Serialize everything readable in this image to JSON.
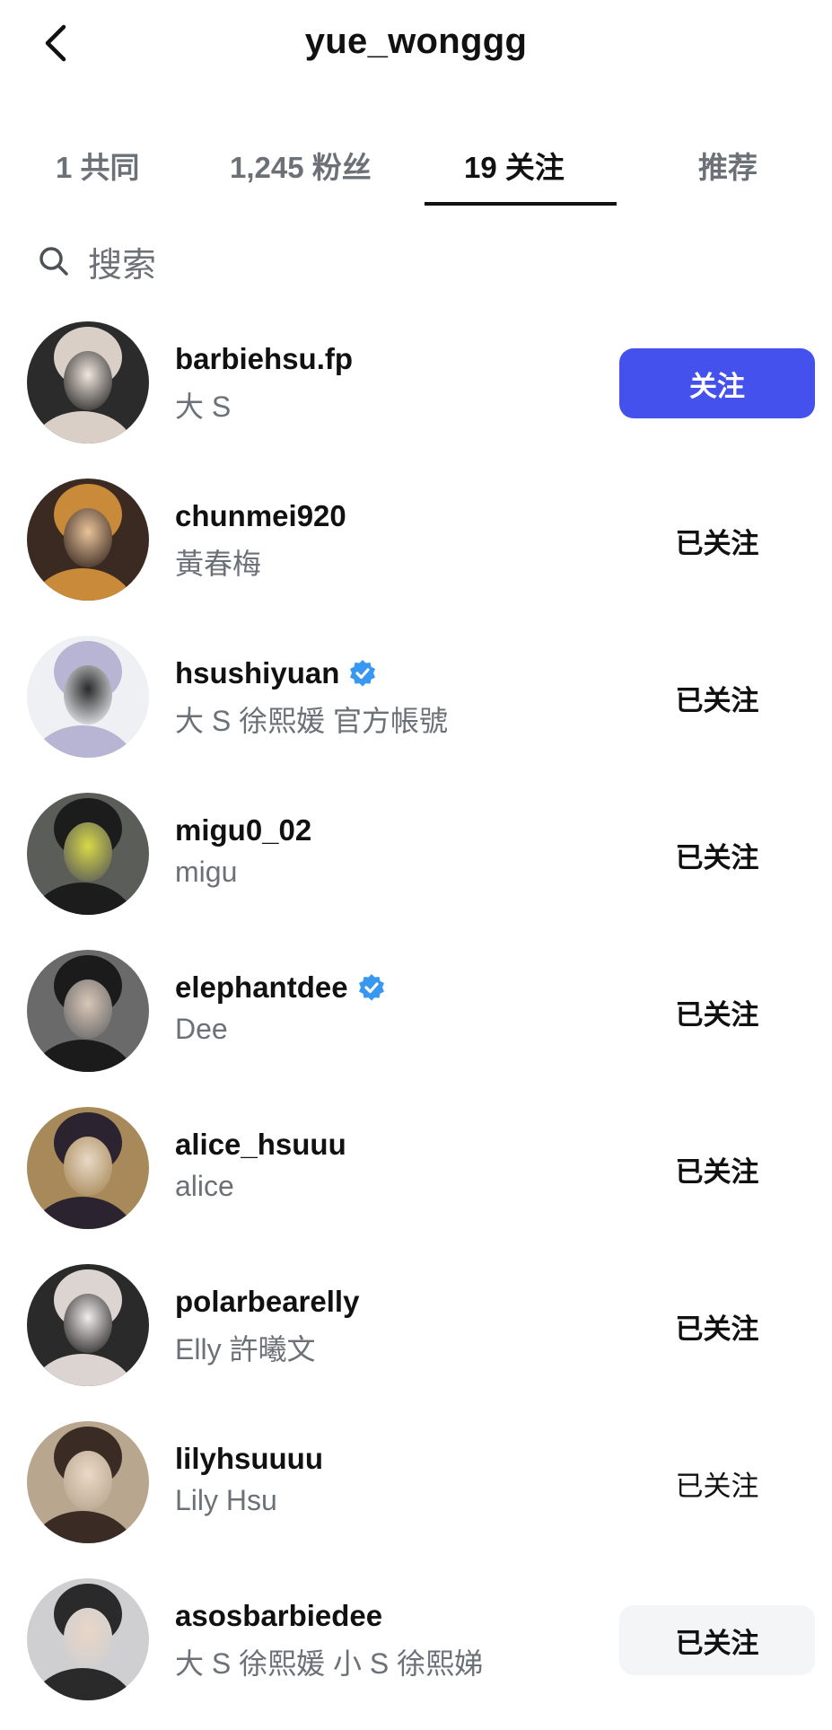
{
  "header": {
    "back_icon": "chevron-left-icon",
    "title": "yue_wonggg"
  },
  "tabs": [
    {
      "label": "1 共同",
      "active": false
    },
    {
      "label": "1,245 粉丝",
      "active": false
    },
    {
      "label": "19 关注",
      "active": true
    },
    {
      "label": "推荐",
      "active": false
    }
  ],
  "search": {
    "icon": "search-icon",
    "placeholder": "搜索"
  },
  "users": [
    {
      "username": "barbiehsu.fp",
      "full_name": "大 S",
      "verified": false,
      "button_label": "关注",
      "button_state": "follow",
      "avatar_colors": [
        "#2b2b2b",
        "#d9cfc6",
        "#f1e6dc"
      ]
    },
    {
      "username": "chunmei920",
      "full_name": "黃春梅",
      "verified": false,
      "button_label": "已关注",
      "button_state": "following",
      "avatar_colors": [
        "#3a2a22",
        "#c98a3a",
        "#e9c39a"
      ]
    },
    {
      "username": "hsushiyuan",
      "full_name": "大 S 徐熙媛  官方帳號",
      "verified": true,
      "button_label": "已关注",
      "button_state": "following",
      "avatar_colors": [
        "#eef0f4",
        "#b7b4d4",
        "#2a2a2a"
      ]
    },
    {
      "username": "migu0_02",
      "full_name": "migu",
      "verified": false,
      "button_label": "已关注",
      "button_state": "following",
      "avatar_colors": [
        "#5b5d58",
        "#1c1c1c",
        "#d8d848"
      ]
    },
    {
      "username": "elephantdee",
      "full_name": "Dee",
      "verified": true,
      "button_label": "已关注",
      "button_state": "following",
      "avatar_colors": [
        "#6a6a6a",
        "#1b1b1b",
        "#d9c6b8"
      ]
    },
    {
      "username": "alice_hsuuu",
      "full_name": "alice",
      "verified": false,
      "button_label": "已关注",
      "button_state": "following",
      "avatar_colors": [
        "#a88a5a",
        "#2c2330",
        "#e8d9c6"
      ]
    },
    {
      "username": "polarbearelly",
      "full_name": "Elly 許曦文",
      "verified": false,
      "button_label": "已关注",
      "button_state": "following",
      "avatar_colors": [
        "#2a2a2a",
        "#dcd4d0",
        "#f2ecea"
      ]
    },
    {
      "username": "lilyhsuuuu",
      "full_name": "Lily Hsu",
      "verified": false,
      "button_label": "已关注",
      "button_state": "following-light",
      "avatar_colors": [
        "#b9a68e",
        "#3a2c24",
        "#ead9c8"
      ]
    },
    {
      "username": "asosbarbiedee",
      "full_name": "大 S 徐熙媛  小 S 徐熙娣",
      "verified": false,
      "button_label": "已关注",
      "button_state": "following-shaded",
      "avatar_colors": [
        "#cfcfd2",
        "#2a2a2a",
        "#e9d6c6"
      ]
    }
  ],
  "colors": {
    "accent": "#4551ec",
    "verified": "#3897f0",
    "secondary_text": "#6b7177"
  }
}
